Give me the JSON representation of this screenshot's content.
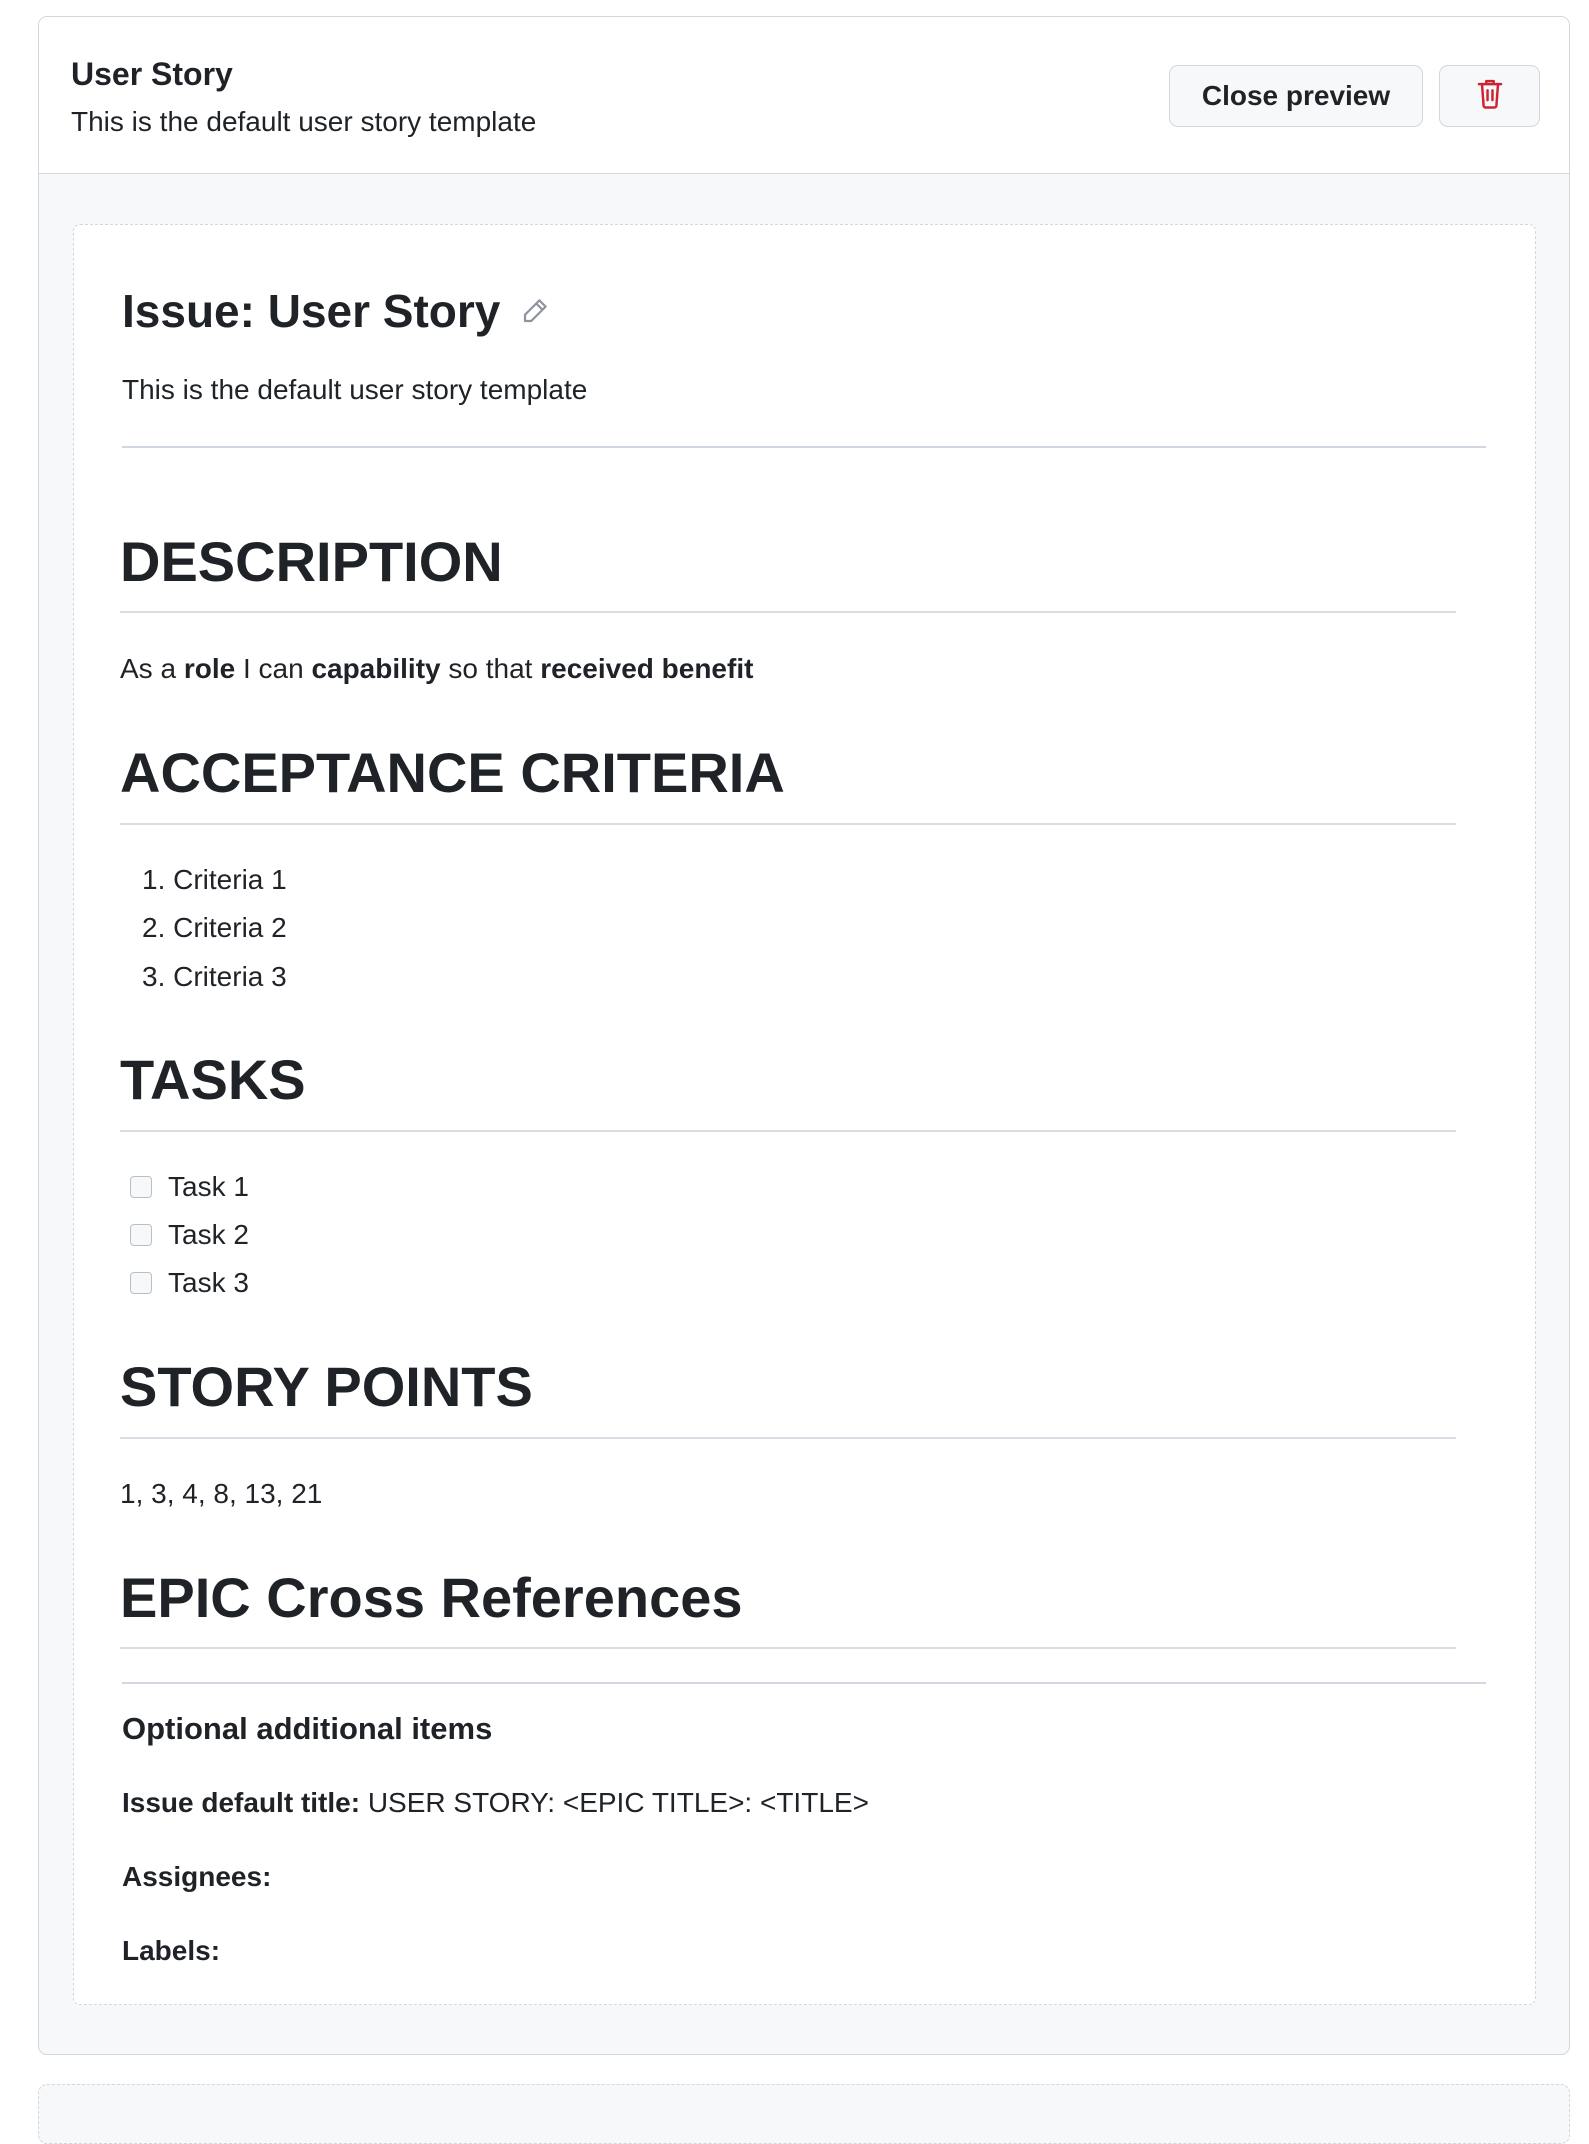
{
  "header": {
    "title": "User Story",
    "subtitle": "This is the default user story template",
    "close_preview_label": "Close preview",
    "delete_icon": "trash-icon",
    "delete_color": "#cf222e"
  },
  "preview": {
    "issue_title": "Issue: User Story",
    "edit_icon": "pencil-icon",
    "issue_description": "This is the default user story template",
    "sections": {
      "description": {
        "heading": "DESCRIPTION",
        "text": {
          "p1": "As a ",
          "b1": "role",
          "p2": " I can ",
          "b2": "capability",
          "p3": " so that ",
          "b3": "received benefit"
        }
      },
      "acceptance": {
        "heading": "ACCEPTANCE CRITERIA",
        "items": [
          "1. Criteria 1",
          "2. Criteria 2",
          "3. Criteria 3"
        ]
      },
      "tasks": {
        "heading": "TASKS",
        "items": [
          {
            "label": "Task 1",
            "checked": false
          },
          {
            "label": "Task 2",
            "checked": false
          },
          {
            "label": "Task 3",
            "checked": false
          }
        ]
      },
      "story_points": {
        "heading": "STORY POINTS",
        "text": "1, 3, 4, 8, 13, 21"
      },
      "epic": {
        "heading": "EPIC Cross References"
      }
    },
    "optional": {
      "title": "Optional additional items",
      "default_title_label": "Issue default title:",
      "default_title_value": " USER STORY: <EPIC TITLE>: <TITLE>",
      "assignees_label": "Assignees:",
      "labels_label": "Labels:"
    }
  }
}
